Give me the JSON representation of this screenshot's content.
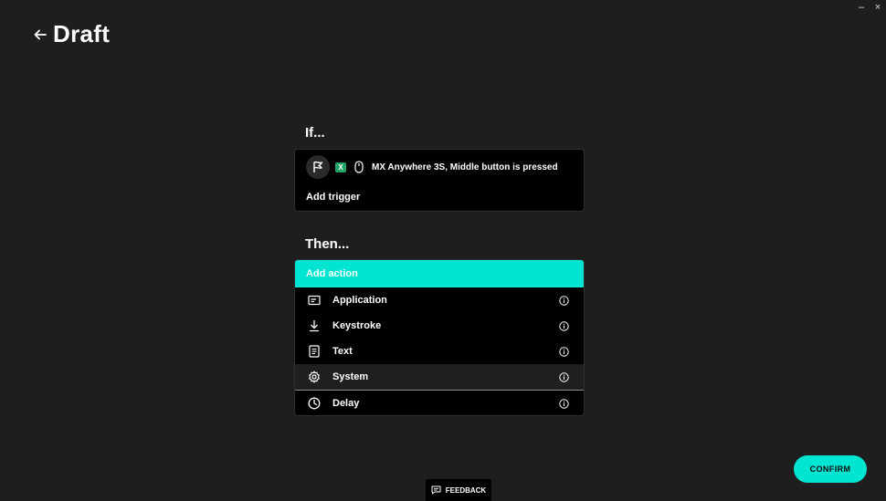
{
  "window": {
    "minimize_label": "–",
    "close_label": "×"
  },
  "header": {
    "title": "Draft",
    "back_icon": "arrow-left-icon"
  },
  "if_section": {
    "label": "If...",
    "trigger": {
      "app_icon": "flag-app-icon",
      "excel_icon_letter": "X",
      "device_icon": "mouse-icon",
      "text": "MX Anywhere 3S, Middle button is pressed"
    },
    "add_trigger_label": "Add trigger"
  },
  "then_section": {
    "label": "Then...",
    "add_action_label": "Add action",
    "actions": [
      {
        "label": "Application",
        "icon": "application-icon"
      },
      {
        "label": "Keystroke",
        "icon": "download-arrow-icon"
      },
      {
        "label": "Text",
        "icon": "document-icon"
      },
      {
        "label": "System",
        "icon": "gear-icon"
      },
      {
        "label": "Delay",
        "icon": "clock-icon"
      }
    ]
  },
  "footer": {
    "confirm_label": "CONFIRM",
    "feedback_label": "FEEDBACK"
  },
  "colors": {
    "background": "#1e1e1e",
    "panel": "#000000",
    "accent": "#00e5d1",
    "highlight_row": "#1f1f1f"
  }
}
